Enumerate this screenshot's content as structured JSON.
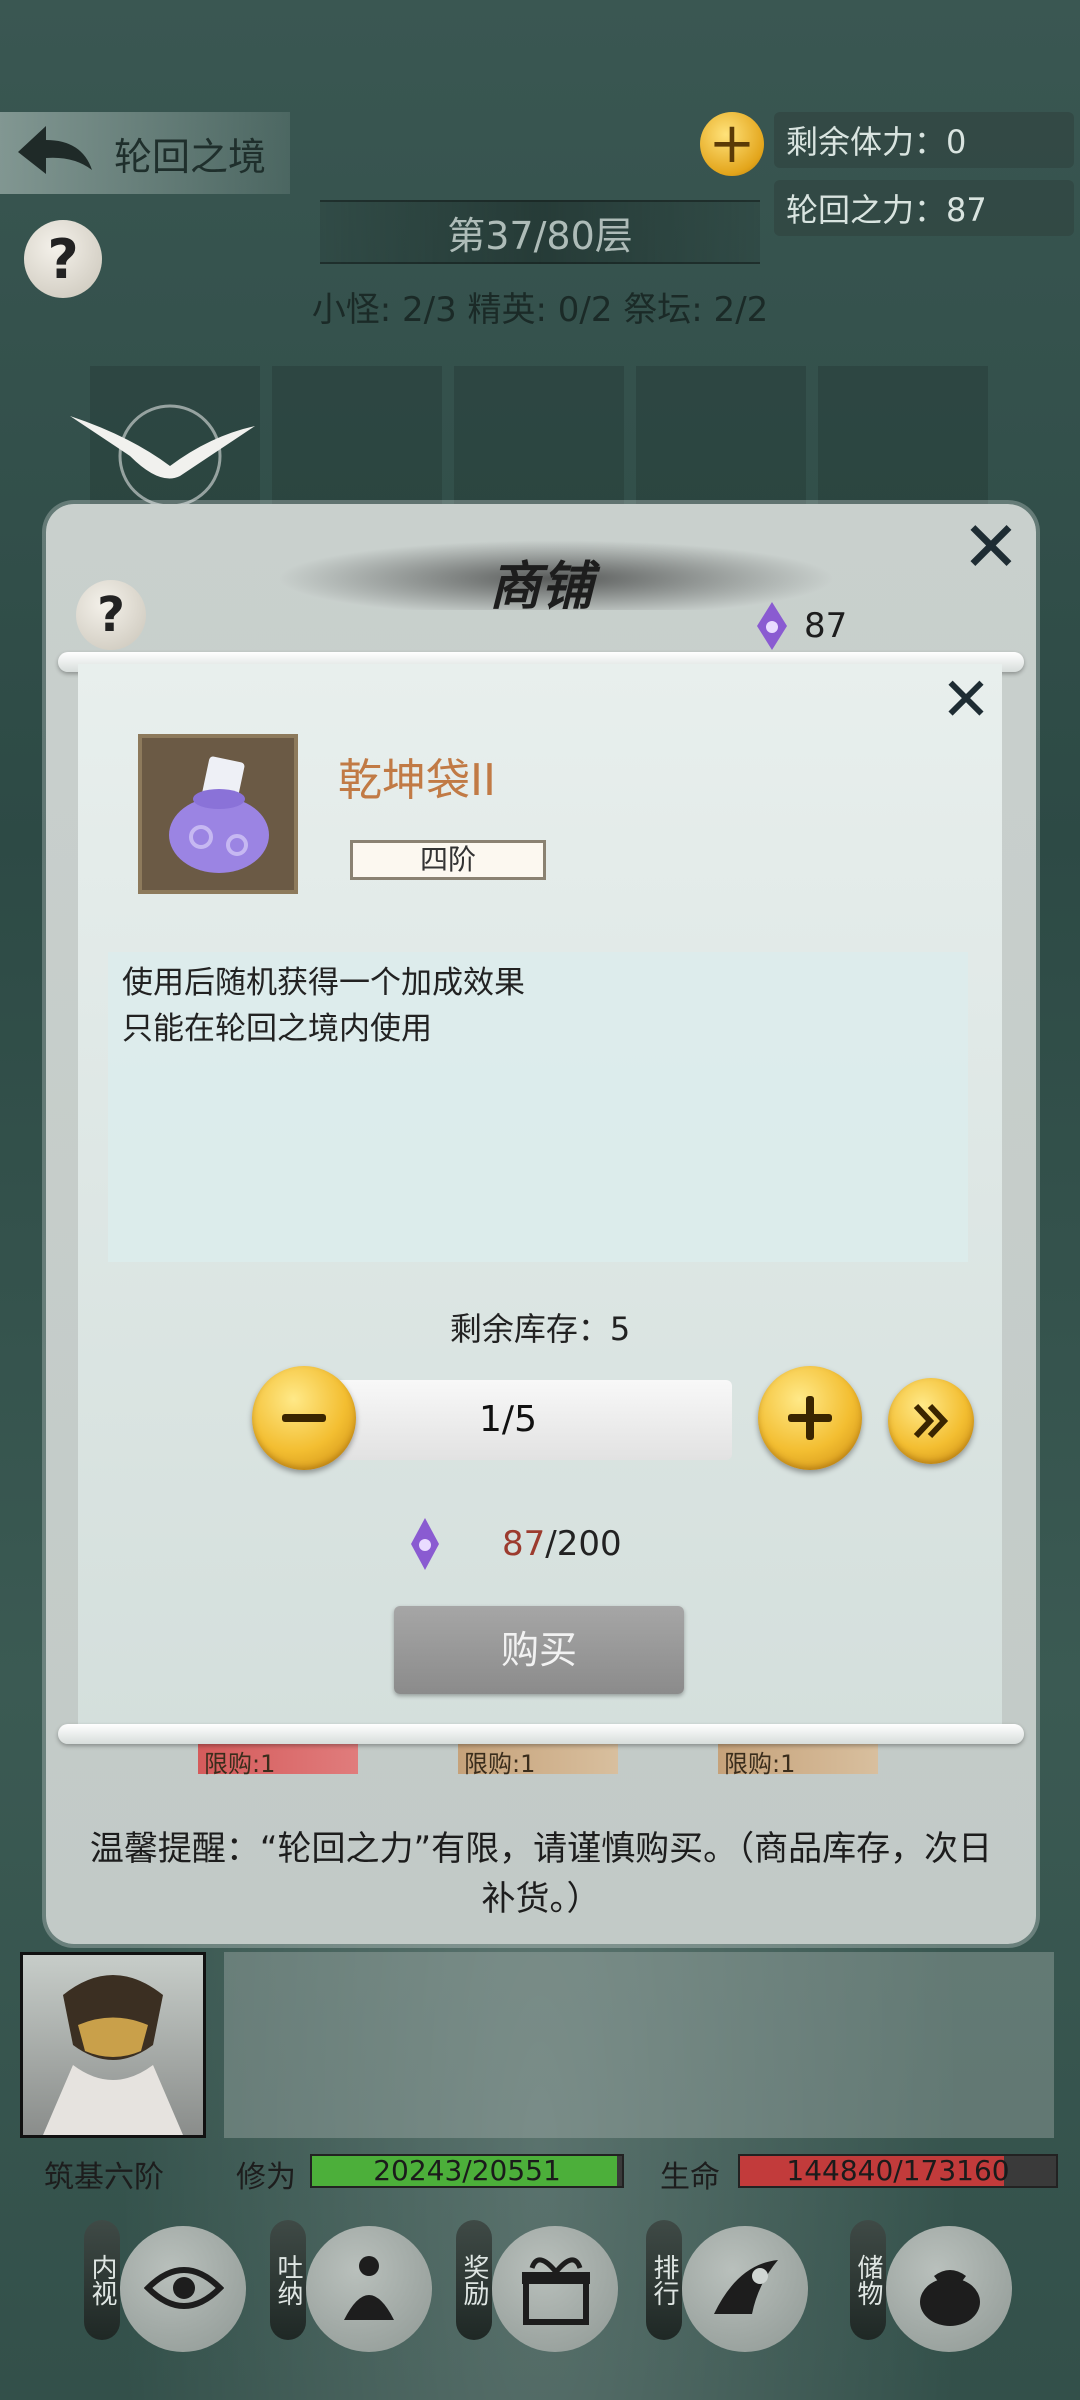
{
  "header": {
    "title": "轮回之境",
    "stamina": "剩余体力：0",
    "reincarnation_power": "轮回之力：87",
    "floor": "第37/80层",
    "counts": "小怪: 2/3 精英: 0/2 祭坛: 2/2"
  },
  "shop": {
    "title": "商铺",
    "currency_amount": "87",
    "tip": "温馨提醒：“轮回之力”有限，请谨慎购买。（商品库存，次日补货。）",
    "limit_tags": [
      "限购:1",
      "限购:1",
      "限购:1"
    ]
  },
  "item_dialog": {
    "name": "乾坤袋II",
    "tier": "四阶",
    "description_lines": [
      "使用后随机获得一个加成效果",
      "只能在轮回之境内使用"
    ],
    "stock": "剩余库存：5",
    "quantity": "1/5",
    "cost_current": "87",
    "cost_separator": "/",
    "cost_price": "200",
    "buy_label": "购买"
  },
  "status": {
    "realm": "筑基六阶",
    "cultivation_label": "修为",
    "cultivation_value": "20243/20551",
    "cultivation_fraction": 0.985,
    "hp_label": "生命",
    "hp_value": "144840/173160",
    "hp_fraction": 0.836
  },
  "nav": [
    {
      "label": "内视",
      "icon": "eye-icon"
    },
    {
      "label": "吐纳",
      "icon": "meditation-icon"
    },
    {
      "label": "奖励",
      "icon": "gift-icon"
    },
    {
      "label": "排行",
      "icon": "ranking-icon"
    },
    {
      "label": "储物",
      "icon": "bag-icon"
    }
  ],
  "colors": {
    "accent_gold": "#f3be31",
    "item_name": "#c17a45",
    "currency_red": "#9c3b2e",
    "cultivation_bar": "#4caf3a",
    "hp_bar": "#c23b3b",
    "crystal_purple": "#8a5bd1"
  }
}
